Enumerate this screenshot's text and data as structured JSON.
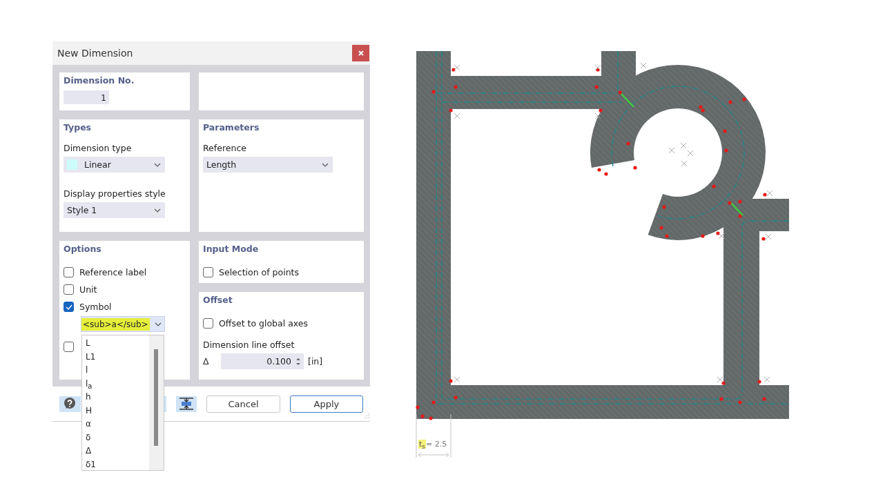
{
  "window": {
    "title": "New Dimension"
  },
  "dimension_no": {
    "label": "Dimension No.",
    "value": "1"
  },
  "types": {
    "heading": "Types",
    "dimension_type": {
      "label": "Dimension type",
      "value": "Linear"
    },
    "display_style": {
      "label": "Display properties style",
      "value": "Style 1"
    }
  },
  "parameters": {
    "heading": "Parameters",
    "reference": {
      "label": "Reference",
      "value": "Length"
    }
  },
  "options": {
    "heading": "Options",
    "checkboxes": [
      {
        "label": "Reference label",
        "checked": false
      },
      {
        "label": "Unit",
        "checked": false
      },
      {
        "label": "Symbol",
        "checked": true
      }
    ],
    "symbol": {
      "value": "<sub>a</sub>",
      "expanded": true,
      "items": [
        "L",
        "L1",
        "l",
        "l$_{a}$",
        "h",
        "H",
        "α",
        "δ",
        "Δ",
        "δ1"
      ]
    },
    "extra_checkbox": {
      "checked": false
    }
  },
  "input_mode": {
    "heading": "Input Mode",
    "checkboxes": [
      {
        "label": "Selection of points",
        "checked": false
      }
    ]
  },
  "offset": {
    "heading": "Offset",
    "checkboxes": [
      {
        "label": "Offset to global axes",
        "checked": false
      }
    ],
    "line_offset": {
      "label": "Dimension line offset",
      "symbol": "Δ",
      "value": "0.100",
      "unit": "[in]"
    }
  },
  "buttons": [
    {
      "label": "Cancel",
      "default": false
    },
    {
      "label": "Apply",
      "default": true
    }
  ],
  "drawing": {
    "dimension_symbol": "t$_{s}$",
    "dimension_value": "= 2.5"
  }
}
